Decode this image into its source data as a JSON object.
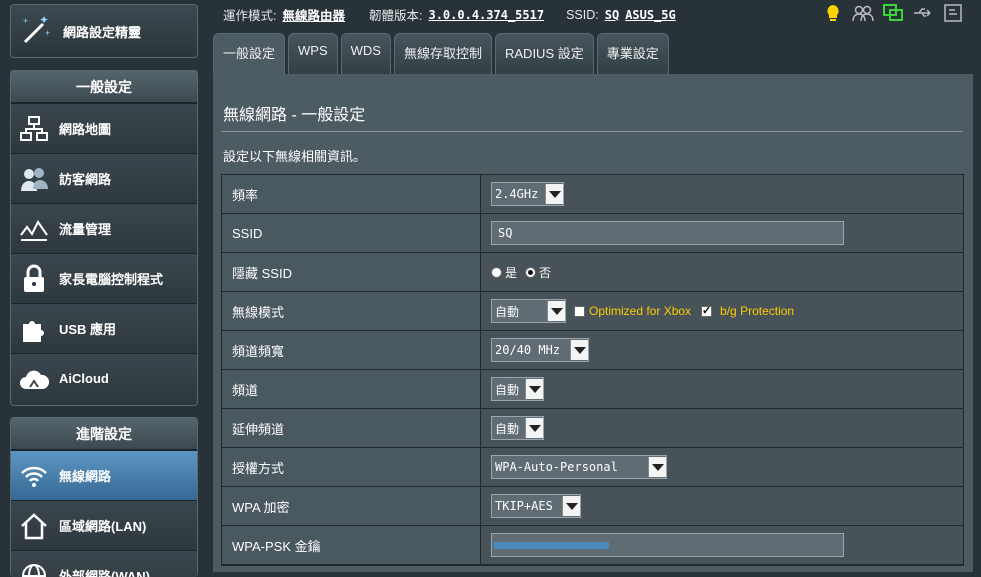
{
  "header": {
    "mode_label": "運作模式:",
    "mode_value": "無線路由器",
    "firmware_label": "韌體版本:",
    "firmware_value": "3.0.0.4.374_5517",
    "ssid_label": "SSID:",
    "ssid_1": "SQ",
    "ssid_2": "ASUS_5G"
  },
  "sidebar": {
    "wizard_label": "網路設定精靈",
    "general_header": "一般設定",
    "general_items": [
      {
        "label": "網路地圖"
      },
      {
        "label": "訪客網路"
      },
      {
        "label": "流量管理"
      },
      {
        "label": "家長電腦控制程式"
      },
      {
        "label": "USB 應用"
      },
      {
        "label": "AiCloud"
      }
    ],
    "advanced_header": "進階設定",
    "advanced_items": [
      {
        "label": "無線網路"
      },
      {
        "label": "區域網路(LAN)"
      },
      {
        "label": "外部網路(WAN)"
      }
    ]
  },
  "tabs": [
    "一般設定",
    "WPS",
    "WDS",
    "無線存取控制",
    "RADIUS 設定",
    "專業設定"
  ],
  "page": {
    "title": "無線網路 - 一般設定",
    "description": "設定以下無線相關資訊。"
  },
  "form": {
    "band_label": "頻率",
    "band_value": "2.4GHz",
    "ssid_label": "SSID",
    "ssid_value": "SQ",
    "hide_label": "隱藏 SSID",
    "hide_yes": "是",
    "hide_no": "否",
    "mode_label": "無線模式",
    "mode_value": "自動",
    "xbox_label": "Optimized for Xbox",
    "bg_label": "b/g Protection",
    "bw_label": "頻道頻寬",
    "bw_value": "20/40 MHz",
    "channel_label": "頻道",
    "channel_value": "自動",
    "ext_label": "延伸頻道",
    "ext_value": "自動",
    "auth_label": "授權方式",
    "auth_value": "WPA-Auto-Personal",
    "enc_label": "WPA 加密",
    "enc_value": "TKIP+AES",
    "psk_label": "WPA-PSK 金鑰"
  },
  "colors": {
    "accent": "#4a8bbf",
    "warning_icon": "#ffd200",
    "online_icon": "#38d438"
  }
}
